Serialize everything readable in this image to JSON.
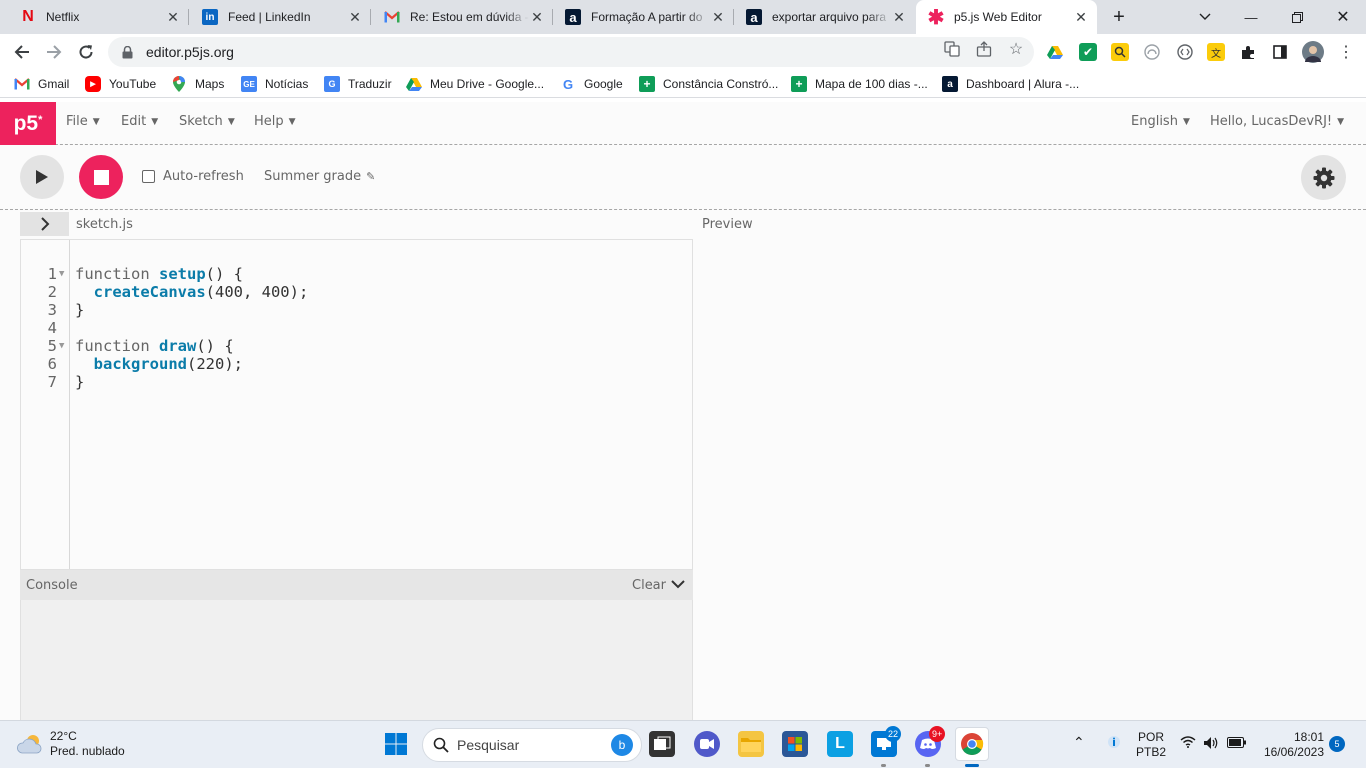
{
  "browser": {
    "tabs": [
      {
        "title": "Netflix"
      },
      {
        "title": "Feed | LinkedIn"
      },
      {
        "title": "Re: Estou em dúvida -"
      },
      {
        "title": "Formação A partir do"
      },
      {
        "title": "exportar arquivo para"
      },
      {
        "title": "p5.js Web Editor"
      }
    ],
    "url": "editor.p5js.org"
  },
  "bookmarks": [
    {
      "label": "Gmail"
    },
    {
      "label": "YouTube"
    },
    {
      "label": "Maps"
    },
    {
      "label": "Notícias"
    },
    {
      "label": "Traduzir"
    },
    {
      "label": "Meu Drive - Google..."
    },
    {
      "label": "Google"
    },
    {
      "label": "Constância Constró..."
    },
    {
      "label": "Mapa de 100 dias -..."
    },
    {
      "label": "Dashboard | Alura -..."
    }
  ],
  "editor": {
    "logo": "p5",
    "menus": [
      "File",
      "Edit",
      "Sketch",
      "Help"
    ],
    "language": "English",
    "user": "Hello, LucasDevRJ!",
    "auto_refresh_label": "Auto-refresh",
    "auto_refresh_checked": false,
    "sketch_name": "Summer grade",
    "file_name": "sketch.js",
    "preview_label": "Preview",
    "console_label": "Console",
    "clear_label": "Clear",
    "code": {
      "line_numbers": [
        "1",
        "2",
        "3",
        "4",
        "5",
        "6",
        "7"
      ],
      "lines": [
        "function setup() {",
        "  createCanvas(400, 400);",
        "}",
        "",
        "function draw() {",
        "  background(220);",
        "}"
      ]
    }
  },
  "taskbar": {
    "weather_temp": "22°C",
    "weather_desc": "Pred. nublado",
    "search_placeholder": "Pesquisar",
    "badge_zoom": "22",
    "badge_discord": "9+",
    "lang_top": "POR",
    "lang_bottom": "PTB2",
    "time": "18:01",
    "date": "16/06/2023",
    "notifications": "5"
  }
}
